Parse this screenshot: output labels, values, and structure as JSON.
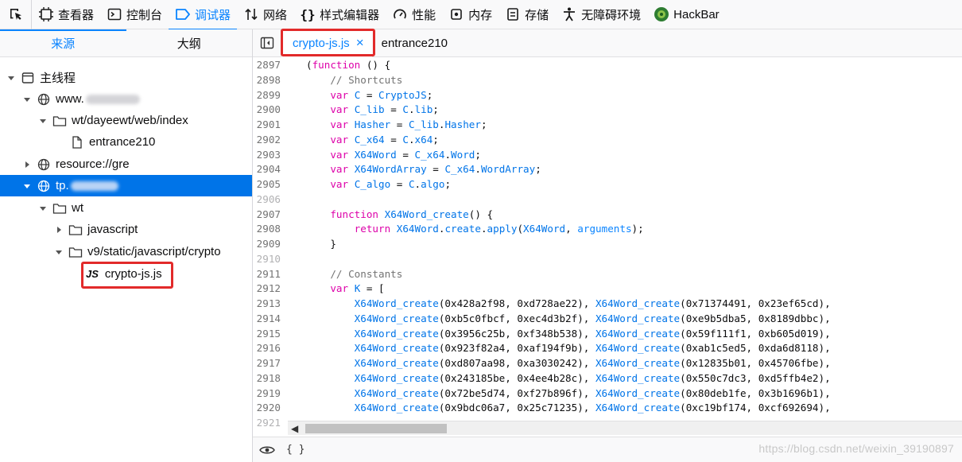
{
  "toolbar": {
    "items": [
      {
        "label": "查看器"
      },
      {
        "label": "控制台"
      },
      {
        "label": "调试器"
      },
      {
        "label": "网络"
      },
      {
        "label": "样式编辑器"
      },
      {
        "label": "性能"
      },
      {
        "label": "内存"
      },
      {
        "label": "存储"
      },
      {
        "label": "无障碍环境"
      },
      {
        "label": "HackBar"
      }
    ],
    "active_color": "#0a84ff"
  },
  "left_panel": {
    "tabs": [
      "来源",
      "大纲"
    ],
    "tree": [
      {
        "label": "主线程"
      },
      {
        "label": "www."
      },
      {
        "label": "wt/dayeewt/web/index"
      },
      {
        "label": "entrance210"
      },
      {
        "label": "resource://gre"
      },
      {
        "label": "tp."
      },
      {
        "label": "wt"
      },
      {
        "label": "javascript"
      },
      {
        "label": "v9/static/javascript/crypto"
      },
      {
        "label": "crypto-js.js",
        "badge": "JS"
      }
    ],
    "selected_color": "#0074e8"
  },
  "editor": {
    "tabs": [
      {
        "label": "crypto-js.js",
        "close": "×"
      },
      {
        "label": "entrance210"
      }
    ],
    "footer_braces": "{ }"
  },
  "code_lines": [
    {
      "n": "2897",
      "t": "(function () {"
    },
    {
      "n": "2898",
      "t": "    // Shortcuts"
    },
    {
      "n": "2899",
      "t": "    var C = CryptoJS;"
    },
    {
      "n": "2900",
      "t": "    var C_lib = C.lib;"
    },
    {
      "n": "2901",
      "t": "    var Hasher = C_lib.Hasher;"
    },
    {
      "n": "2902",
      "t": "    var C_x64 = C.x64;"
    },
    {
      "n": "2903",
      "t": "    var X64Word = C_x64.Word;"
    },
    {
      "n": "2904",
      "t": "    var X64WordArray = C_x64.WordArray;"
    },
    {
      "n": "2905",
      "t": "    var C_algo = C.algo;"
    },
    {
      "n": "2906",
      "t": ""
    },
    {
      "n": "2907",
      "t": "    function X64Word_create() {"
    },
    {
      "n": "2908",
      "t": "        return X64Word.create.apply(X64Word, arguments);"
    },
    {
      "n": "2909",
      "t": "    }"
    },
    {
      "n": "2910",
      "t": ""
    },
    {
      "n": "2911",
      "t": "    // Constants"
    },
    {
      "n": "2912",
      "t": "    var K = ["
    },
    {
      "n": "2913",
      "t": "        X64Word_create(0x428a2f98, 0xd728ae22), X64Word_create(0x71374491, 0x23ef65cd),"
    },
    {
      "n": "2914",
      "t": "        X64Word_create(0xb5c0fbcf, 0xec4d3b2f), X64Word_create(0xe9b5dba5, 0x8189dbbc),"
    },
    {
      "n": "2915",
      "t": "        X64Word_create(0x3956c25b, 0xf348b538), X64Word_create(0x59f111f1, 0xb605d019),"
    },
    {
      "n": "2916",
      "t": "        X64Word_create(0x923f82a4, 0xaf194f9b), X64Word_create(0xab1c5ed5, 0xda6d8118),"
    },
    {
      "n": "2917",
      "t": "        X64Word_create(0xd807aa98, 0xa3030242), X64Word_create(0x12835b01, 0x45706fbe),"
    },
    {
      "n": "2918",
      "t": "        X64Word_create(0x243185be, 0x4ee4b28c), X64Word_create(0x550c7dc3, 0xd5ffb4e2),"
    },
    {
      "n": "2919",
      "t": "        X64Word_create(0x72be5d74, 0xf27b896f), X64Word_create(0x80deb1fe, 0x3b1696b1),"
    },
    {
      "n": "2920",
      "t": "        X64Word_create(0x9bdc06a7, 0x25c71235), X64Word_create(0xc19bf174, 0xcf692694),"
    },
    {
      "n": "2921",
      "t": ""
    }
  ],
  "watermark": "https://blog.csdn.net/weixin_39190897"
}
